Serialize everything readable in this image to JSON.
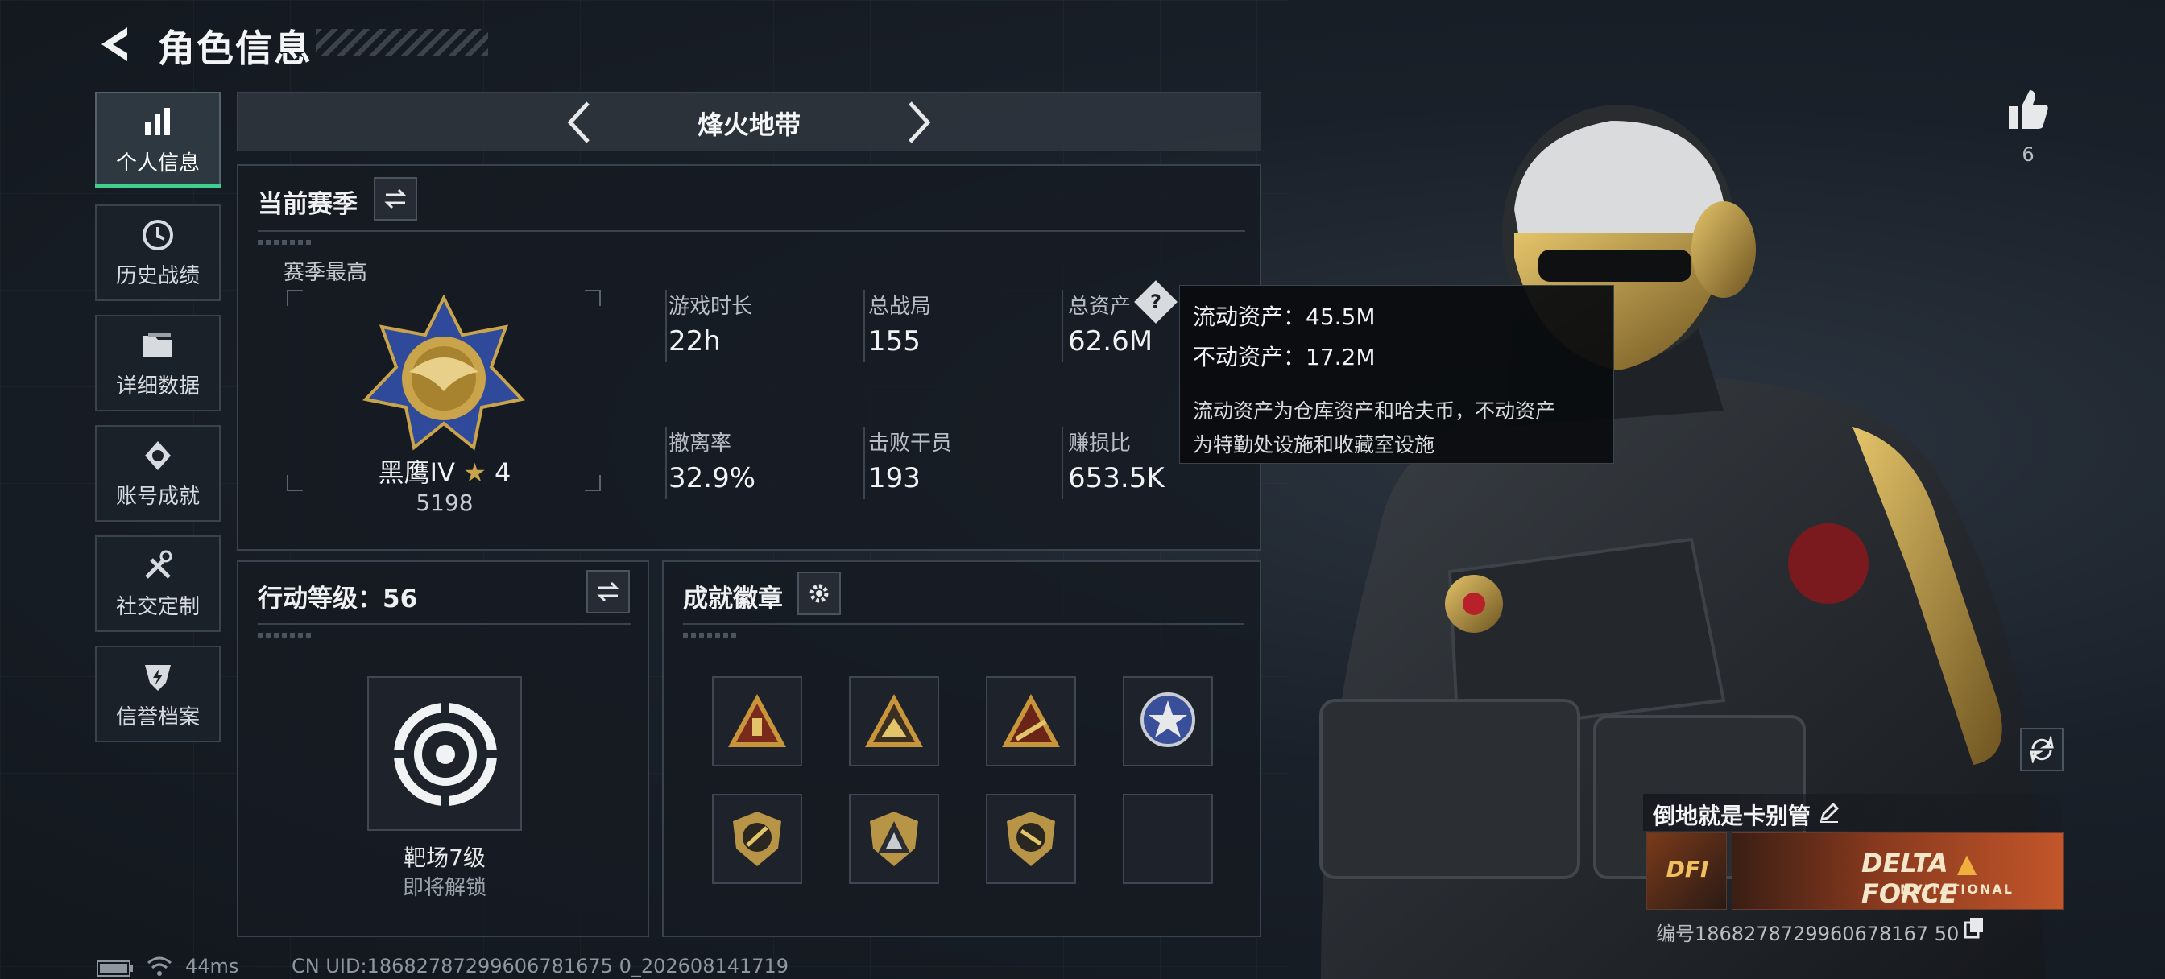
{
  "header": {
    "title": "角色信息"
  },
  "sidebar": {
    "items": [
      {
        "label": "个人信息",
        "icon": "bar-chart-icon",
        "active": true
      },
      {
        "label": "历史战绩",
        "icon": "history-clock-icon",
        "active": false
      },
      {
        "label": "详细数据",
        "icon": "folder-icon",
        "active": false
      },
      {
        "label": "账号成就",
        "icon": "achievement-medal-icon",
        "active": false
      },
      {
        "label": "社交定制",
        "icon": "tools-icon",
        "active": false
      },
      {
        "label": "信誉档案",
        "icon": "credit-emblem-icon",
        "active": false
      }
    ]
  },
  "map_selector": {
    "current": "烽火地带"
  },
  "season": {
    "title": "当前赛季",
    "best_label": "赛季最高",
    "rank_name": "黑鹰IV",
    "rank_stars": "4",
    "rank_score": "5198",
    "stats": [
      {
        "label": "游戏时长",
        "value": "22h"
      },
      {
        "label": "总战局",
        "value": "155"
      },
      {
        "label": "总资产",
        "value": "62.6M"
      },
      {
        "label": "撤离率",
        "value": "32.9%"
      },
      {
        "label": "击败干员",
        "value": "193"
      },
      {
        "label": "赚损比",
        "value": "653.5K"
      }
    ]
  },
  "tooltip": {
    "liquid": "流动资产：45.5M",
    "fixed": "不动资产：17.2M",
    "desc_line1": "流动资产为仓库资产和哈夫币，不动资产",
    "desc_line2": "为特勤处设施和收藏室设施"
  },
  "action_level": {
    "title": "行动等级：56",
    "item_name": "靶场7级",
    "item_status": "即将解锁"
  },
  "badges": {
    "title": "成就徽章"
  },
  "likes": {
    "count": "6"
  },
  "player": {
    "name": "倒地就是卡别管",
    "banner_text_1": "DELTA",
    "banner_text_2": "FORCE",
    "banner_text_3": "INVITATIONAL",
    "banner_small": "DFI",
    "id_line": "编号1868278729960678167 50"
  },
  "footer": {
    "ping": "44ms",
    "uid": "CN UID:18682787299606781675 0_202608141719"
  },
  "colors": {
    "accent_green": "#3fd08f",
    "gold": "#c9a44a"
  }
}
